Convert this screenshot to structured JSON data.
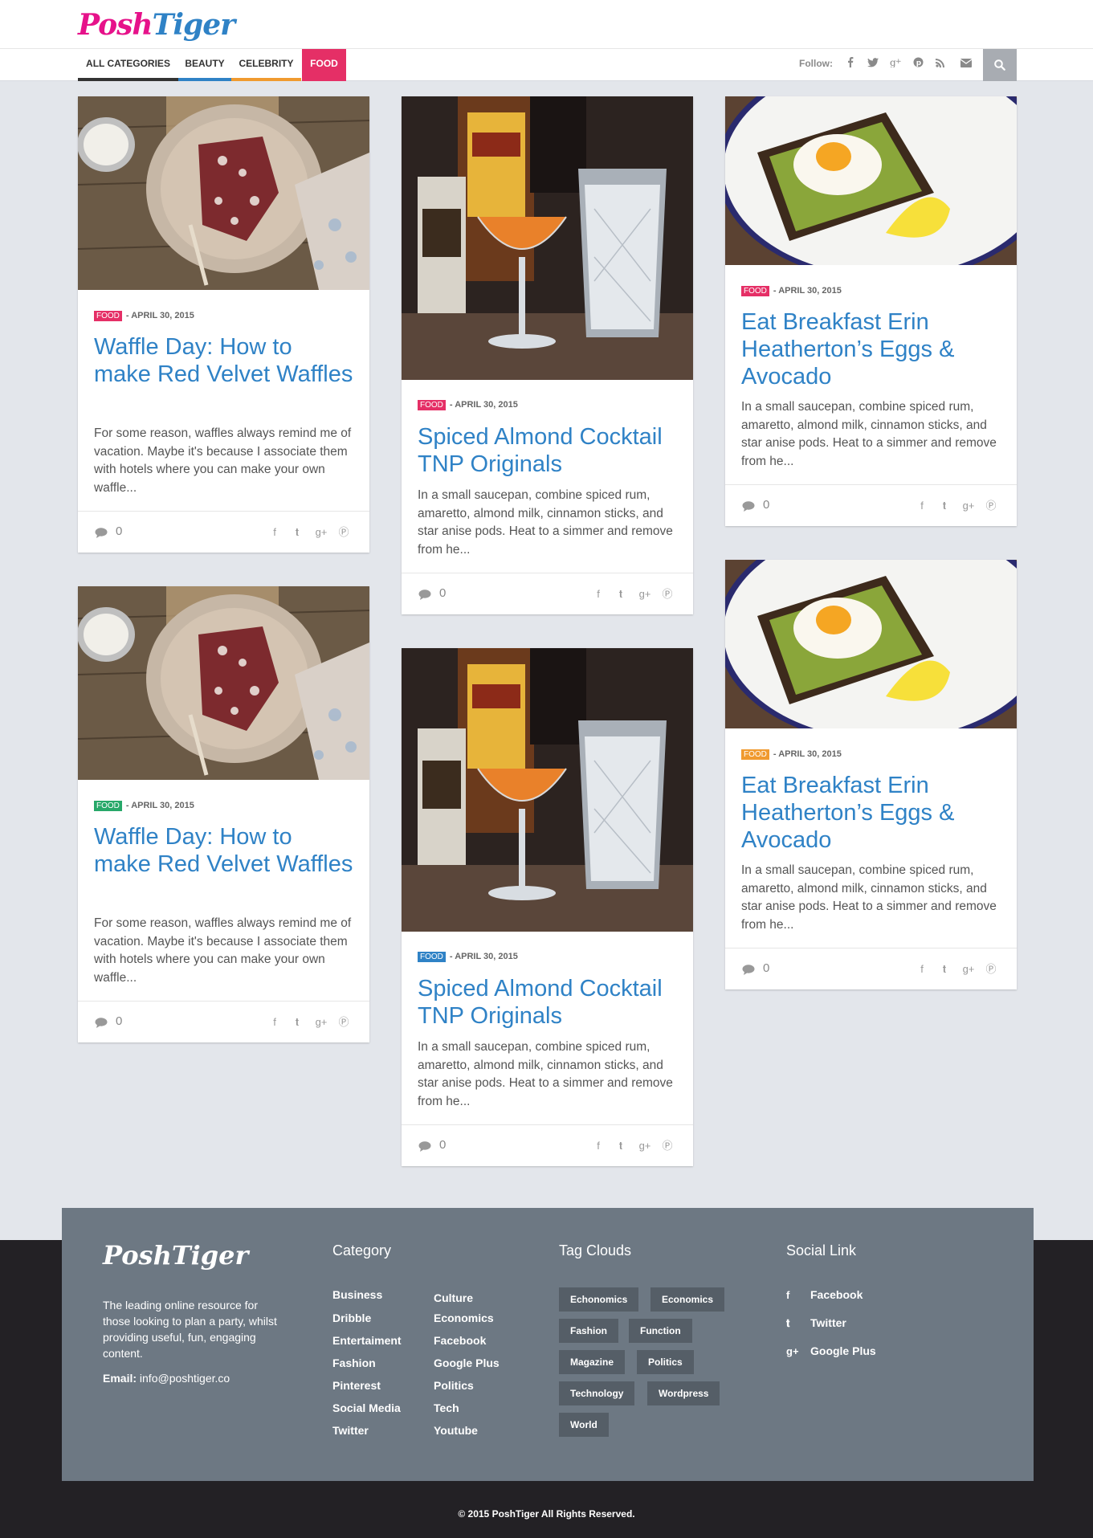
{
  "site": {
    "logo_part1": "Posh",
    "logo_part2": "Tiger"
  },
  "nav": {
    "items": [
      "ALL CATEGORIES",
      "BEAUTY",
      "CELEBRITY",
      "FOOD"
    ],
    "active": "FOOD",
    "follow_label": "Follow:",
    "follow_icons": [
      "facebook-icon",
      "twitter-icon",
      "google-plus-icon",
      "pinterest-icon",
      "rss-icon",
      "email-icon"
    ],
    "search_icon": "search-icon"
  },
  "colors": {
    "brand_pink": "#e6128a",
    "brand_blue": "#2f82c6",
    "food_red": "#e52f66",
    "food_green": "#27a869",
    "food_blue": "#2f82c6",
    "food_orange": "#f09a2f"
  },
  "cards": [
    {
      "image": "red velvet waffles on plate",
      "category": "FOOD",
      "category_color": "#e52f66",
      "date": "- APRIL 30, 2015",
      "title": "Waffle Day: How to make Red Velvet Waffles",
      "excerpt": "For some reason, waffles always remind me of vacation. Maybe it's because I associate them with hotels where you can make your own waffle...",
      "comments": "0"
    },
    {
      "image": "orange cocktail with bottles",
      "category": "FOOD",
      "category_color": "#e52f66",
      "date": "- APRIL 30, 2015",
      "title": "Spiced Almond Cocktail TNP Originals",
      "excerpt": "In a small saucepan, combine spiced rum, amaretto, almond milk, cinnamon sticks, and star anise pods. Heat to a simmer and remove from he...",
      "comments": "0"
    },
    {
      "image": "egg and avocado toast",
      "category": "FOOD",
      "category_color": "#e52f66",
      "date": "- APRIL 30, 2015",
      "title": "Eat Breakfast Erin Heatherton’s Eggs & Avocado",
      "excerpt": "In a small saucepan, combine spiced rum, amaretto, almond milk, cinnamon sticks, and star anise pods. Heat to a simmer and remove from he...",
      "comments": "0"
    },
    {
      "image": "red velvet waffles on plate",
      "category": "FOOD",
      "category_color": "#27a869",
      "date": "- APRIL 30, 2015",
      "title": "Waffle Day: How to make Red Velvet Waffles",
      "excerpt": "For some reason, waffles always remind me of vacation. Maybe it's because I associate them with hotels where you can make your own waffle...",
      "comments": "0"
    },
    {
      "image": "orange cocktail with bottles",
      "category": "FOOD",
      "category_color": "#2f82c6",
      "date": "- APRIL 30, 2015",
      "title": "Spiced Almond Cocktail TNP Originals",
      "excerpt": "In a small saucepan, combine spiced rum, amaretto, almond milk, cinnamon sticks, and star anise pods. Heat to a simmer and remove from he...",
      "comments": "0"
    },
    {
      "image": "egg and avocado toast",
      "category": "FOOD",
      "category_color": "#f09a2f",
      "date": "- APRIL 30, 2015",
      "title": "Eat Breakfast Erin Heatherton’s Eggs & Avocado",
      "excerpt": "In a small saucepan, combine spiced rum, amaretto, almond milk, cinnamon sticks, and star anise pods. Heat to a simmer and remove from he...",
      "comments": "0"
    }
  ],
  "card_share_icons": [
    "facebook-icon",
    "twitter-icon",
    "google-plus-icon",
    "pinterest-icon"
  ],
  "footer": {
    "logo": "PoshTiger",
    "about": "The leading online resource for those looking to plan a party, whilst providing useful, fun, engaging content.",
    "email_label": "Email:",
    "email": "info@poshtiger.co",
    "category_heading": "Category",
    "categories_col1": [
      "Business",
      "Dribble",
      "Entertaiment",
      "Fashion",
      "Pinterest",
      "Social Media",
      "Twitter"
    ],
    "categories_col2": [
      "Culture",
      "Economics",
      "Facebook",
      "Google Plus",
      "Politics",
      "Tech",
      "Youtube"
    ],
    "tags_heading": "Tag Clouds",
    "tags": [
      "Echonomics",
      "Economics",
      "Fashion",
      "Function",
      "Magazine",
      "Politics",
      "Technology",
      "Wordpress",
      "World"
    ],
    "social_heading": "Social Link",
    "social": [
      {
        "icon": "facebook-icon",
        "label": "Facebook"
      },
      {
        "icon": "twitter-icon",
        "label": "Twitter"
      },
      {
        "icon": "google-plus-icon",
        "label": "Google Plus"
      }
    ],
    "copyright": "© 2015 PoshTiger All Rights Reserved."
  }
}
